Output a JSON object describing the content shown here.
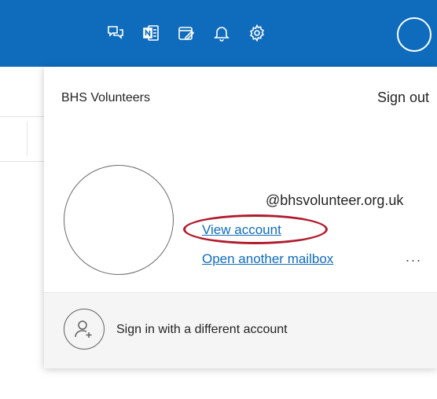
{
  "header": {
    "icons": [
      "teams-chat-icon",
      "onenote-icon",
      "my-day-icon",
      "bell-icon",
      "gear-icon",
      "profile-avatar"
    ]
  },
  "account_panel": {
    "org_name": "BHS Volunteers",
    "sign_out_label": "Sign out",
    "email": "@bhsvolunteer.org.uk",
    "view_account_label": "View account",
    "open_mailbox_label": "Open another mailbox",
    "more_label": "...",
    "different_account_label": "Sign in with a different account"
  },
  "annotation": {
    "color": "#b01c2e"
  },
  "colors": {
    "header_bg": "#0f6cbd",
    "link": "#0f6cbd"
  }
}
